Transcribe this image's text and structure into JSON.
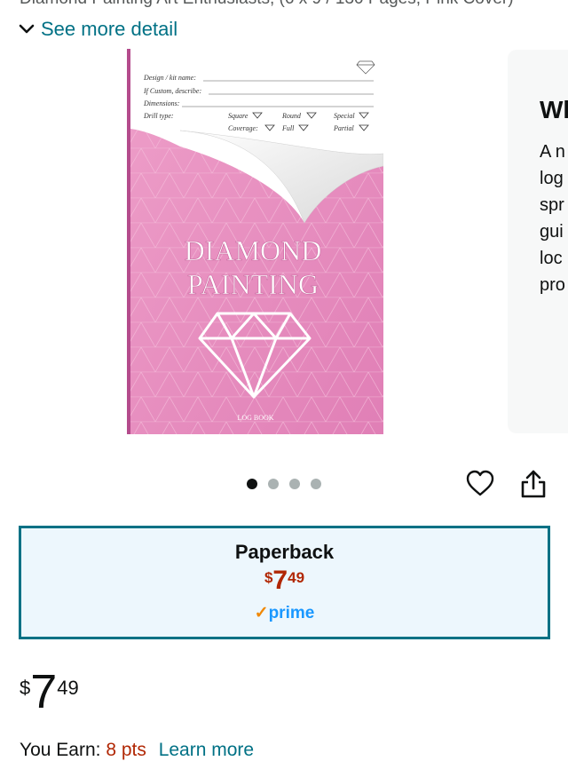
{
  "header": {
    "cut_subtitle": "Diamond Painting Art Enthusiasts, (6 x 9 / 130 Pages, Pink Cover)",
    "see_more_label": "See more detail"
  },
  "cover": {
    "form": {
      "design_label": "Design / kit name:",
      "custom_label": "If Custom, describe:",
      "dimensions_label": "Dimensions:",
      "drill_label": "Drill type:",
      "square": "Square",
      "round": "Round",
      "special": "Special",
      "coverage": "Coverage:",
      "full": "Full",
      "partial": "Partial"
    },
    "title_line1": "DIAMOND",
    "title_line2": "PAINTING",
    "subtitle": "LOG BOOK",
    "colors": {
      "pink": "#e691c0",
      "pink_dark": "#c96aa5",
      "spine": "#b44b8c"
    }
  },
  "side_card": {
    "heading": "Wh",
    "lines": [
      "A n",
      "log",
      "spr",
      "gui",
      "loc",
      "pro"
    ]
  },
  "carousel": {
    "count": 4,
    "active": 0
  },
  "icons": {
    "heart": "heart-icon",
    "share": "share-icon",
    "chevron": "chevron-down-icon"
  },
  "format": {
    "title": "Paperback",
    "price_symbol": "$",
    "price_whole": "7",
    "price_fraction": "49",
    "prime_check": "✓",
    "prime_label": "prime",
    "colors": {
      "border": "#007185",
      "background": "#edf7fd",
      "price": "#b12704",
      "prime": "#1a98ff"
    }
  },
  "price": {
    "symbol": "$",
    "whole": "7",
    "fraction": "49"
  },
  "earn": {
    "label": "You Earn:",
    "points": "8 pts",
    "learn_more": "Learn more"
  }
}
